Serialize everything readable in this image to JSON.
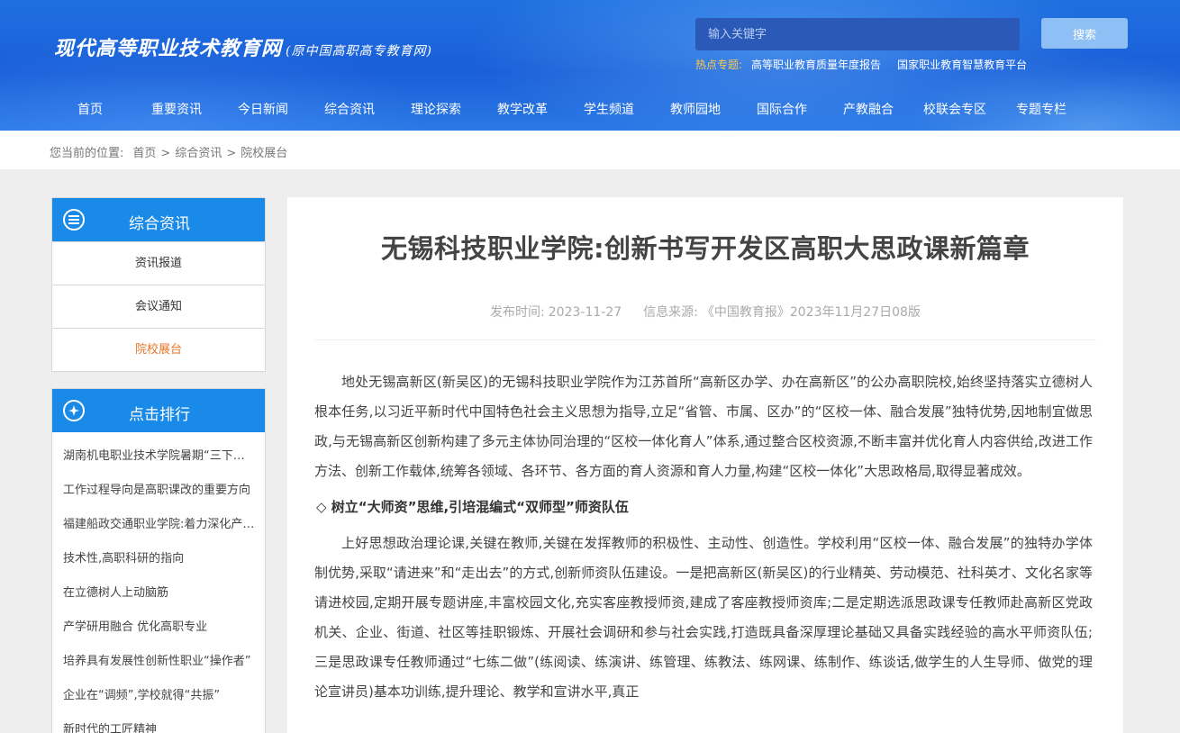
{
  "header": {
    "logo_main": "现代高等职业技术教育网",
    "logo_sub": "(原中国高职高专教育网)",
    "search_placeholder": "输入关键字",
    "search_button": "搜索",
    "hot_label": "热点专题:",
    "hot_links": [
      "高等职业教育质量年度报告",
      "国家职业教育智慧教育平台"
    ]
  },
  "nav": [
    "首页",
    "重要资讯",
    "今日新闻",
    "综合资讯",
    "理论探索",
    "教学改革",
    "学生频道",
    "教师园地",
    "国际合作",
    "产教融合",
    "校联会专区",
    "专题专栏"
  ],
  "breadcrumb": {
    "label": "您当前的位置:",
    "items": [
      "首页",
      "综合资讯",
      "院校展台"
    ],
    "separator": ">"
  },
  "sidebar": {
    "category": {
      "title": "综合资讯",
      "items": [
        "资讯报道",
        "会议通知",
        "院校展台"
      ],
      "active_index": 2
    },
    "ranking": {
      "title": "点击排行",
      "items": [
        "湖南机电职业技术学院暑期“三下乡”社会实践",
        "工作过程导向是高职课改的重要方向",
        "福建船政交通职业学院:着力深化产教融合",
        "技术性,高职科研的指向",
        "在立德树人上动脑筋",
        "产学研用融合 优化高职专业",
        "培养具有发展性创新性职业“操作者”",
        "企业在“调频”,学校就得“共振”",
        "新时代的工匠精神"
      ]
    }
  },
  "article": {
    "title": "无锡科技职业学院:创新书写开发区高职大思政课新篇章",
    "publish_label": "发布时间:",
    "publish_date": "2023-11-27",
    "source_label": "信息来源:",
    "source": "《中国教育报》2023年11月27日08版",
    "paragraph1": "地处无锡高新区(新吴区)的无锡科技职业学院作为江苏首所“高新区办学、办在高新区”的公办高职院校,始终坚持落实立德树人根本任务,以习近平新时代中国特色社会主义思想为指导,立足“省管、市属、区办”的“区校一体、融合发展”独特优势,因地制宜做思政,与无锡高新区创新构建了多元主体协同治理的“区校一体化育人”体系,通过整合区校资源,不断丰富并优化育人内容供给,改进工作方法、创新工作载体,统筹各领域、各环节、各方面的育人资源和育人力量,构建“区校一体化”大思政格局,取得显著成效。",
    "heading1": "◇ 树立“大师资”思维,引培混编式“双师型”师资队伍",
    "paragraph2": "上好思想政治理论课,关键在教师,关键在发挥教师的积极性、主动性、创造性。学校利用“区校一体、融合发展”的独特办学体制优势,采取“请进来”和“走出去”的方式,创新师资队伍建设。一是把高新区(新吴区)的行业精英、劳动模范、社科英才、文化名家等请进校园,定期开展专题讲座,丰富校园文化,充实客座教授师资,建成了客座教授师资库;二是定期选派思政课专任教师赴高新区党政机关、企业、街道、社区等挂职锻炼、开展社会调研和参与社会实践,打造既具备深厚理论基础又具备实践经验的高水平师资队伍;三是思政课专任教师通过“七练二做”(练阅读、练演讲、练管理、练教法、练网课、练制作、练谈话,做学生的人生导师、做党的理论宣讲员)基本功训练,提升理论、教学和宣讲水平,真正"
  },
  "colors": {
    "header_blue": "#1a5fd8",
    "sidebar_head": "#1a8ae8",
    "active_orange": "#e8772a",
    "hot_label": "#ffc94a"
  }
}
